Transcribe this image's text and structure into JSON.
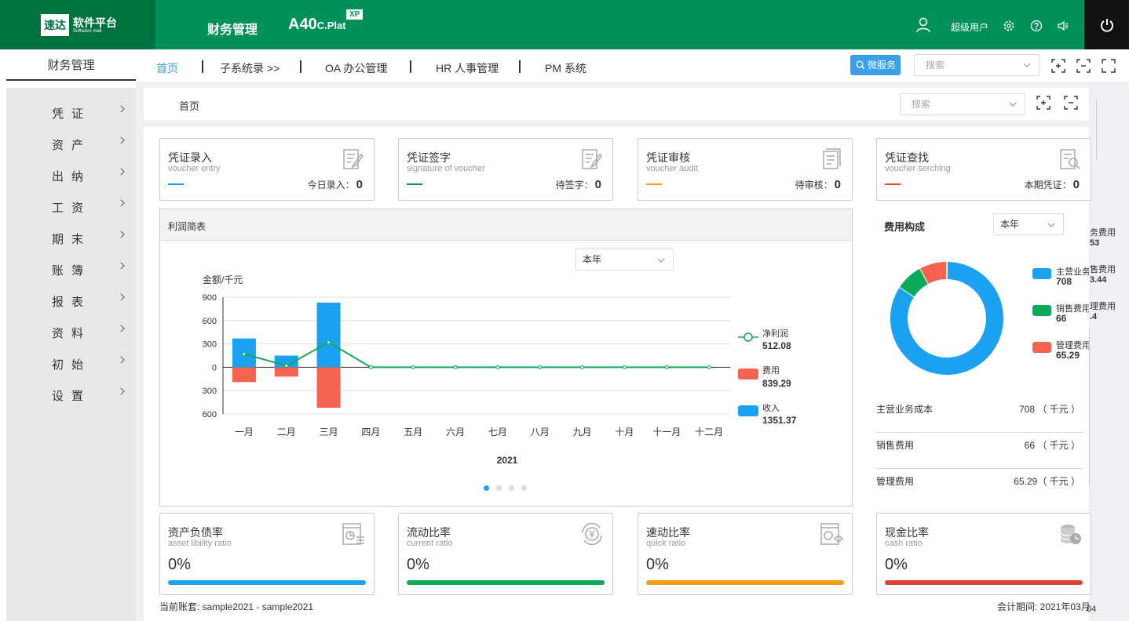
{
  "header": {
    "logo_mark": "速达",
    "logo_text": "软件平台",
    "logo_sub": "Software mall",
    "app_title": "财务管理",
    "brand_main": "A40",
    "brand_sub": "C.Plat",
    "brand_badge": "XP",
    "user_name": "超级用户",
    "icons": [
      "user-icon",
      "gear-icon",
      "help-icon",
      "speaker-icon",
      "power-icon"
    ]
  },
  "module_label": "财务管理",
  "nav": {
    "items": [
      "首页",
      "子系统录 >>",
      "OA 办公管理",
      "HR 人事管理",
      "PM 系统"
    ],
    "micro_label": "微服务",
    "search_placeholder": "搜索"
  },
  "sidebar": {
    "items": [
      "凭证",
      "资产",
      "出纳",
      "工资",
      "期末",
      "账簿",
      "报表",
      "资料",
      "初始",
      "设置"
    ]
  },
  "breadcrumb": {
    "label": "首页",
    "search_placeholder": "搜索"
  },
  "cards": [
    {
      "title": "凭证录入",
      "subtitle": "voucher entry",
      "count_label": "今日录入：",
      "count": "0",
      "color": "#1b9ad8"
    },
    {
      "title": "凭证签字",
      "subtitle": "signature of voucher",
      "count_label": "待签字：",
      "count": "0",
      "color": "#0e8b63"
    },
    {
      "title": "凭证审核",
      "subtitle": "voucher audit",
      "count_label": "待审核：",
      "count": "0",
      "color": "#e8a21a"
    },
    {
      "title": "凭证查找",
      "subtitle": "voucher serching",
      "count_label": "本期凭证：",
      "count": "0",
      "color": "#d9433a"
    }
  ],
  "profit_panel": {
    "title": "利润简表",
    "period": "本年"
  },
  "chart_data": {
    "type": "bar",
    "title": "",
    "ylabel": "金额/千元",
    "xlabel": "2021",
    "categories": [
      "一月",
      "二月",
      "三月",
      "四月",
      "五月",
      "六月",
      "七月",
      "八月",
      "九月",
      "十月",
      "十一月",
      "十二月"
    ],
    "ylim": [
      -600,
      900
    ],
    "yticks": [
      900,
      600,
      300,
      0,
      300,
      600
    ],
    "series": [
      {
        "name": "收入",
        "type": "bar",
        "color": "#1aa1f0",
        "values": [
          370,
          150,
          830,
          0,
          0,
          0,
          0,
          0,
          0,
          0,
          0,
          0
        ]
      },
      {
        "name": "费用",
        "type": "bar",
        "color": "#f4634f",
        "values": [
          -190,
          -120,
          -520,
          0,
          0,
          0,
          0,
          0,
          0,
          0,
          0,
          0
        ]
      },
      {
        "name": "净利润",
        "type": "line",
        "color": "#13a85a",
        "values": [
          170,
          20,
          320,
          0,
          0,
          0,
          0,
          0,
          0,
          0,
          0,
          0
        ]
      }
    ],
    "legend": [
      {
        "name": "净利润",
        "value": "512.08"
      },
      {
        "name": "费用",
        "value": "839.29"
      },
      {
        "name": "收入",
        "value": "1351.37"
      }
    ],
    "legend_position": "right"
  },
  "expense": {
    "title": "费用构成",
    "period": "本年",
    "legend": [
      {
        "name": "主营业务",
        "value": "708",
        "color": "#1aa1f0"
      },
      {
        "name": "销售费用",
        "value": "66",
        "color": "#0bab5b"
      },
      {
        "name": "管理费用",
        "value": "65.29",
        "color": "#f4634f"
      }
    ],
    "rows": [
      {
        "name": "主营业务成本",
        "value": "708 （ 千元 ）"
      },
      {
        "name": "销售费用",
        "value": "66 （ 千元 ）"
      },
      {
        "name": "管理费用",
        "value": "65.29（ 千元 ）"
      }
    ],
    "ghost": [
      "务费用",
      "53",
      "售费用",
      "3.44",
      "理费用",
      ".4"
    ],
    "donut": [
      {
        "name": "主营业务",
        "value": 708,
        "color": "#1aa1f0"
      },
      {
        "name": "销售费用",
        "value": 66,
        "color": "#0bab5b"
      },
      {
        "name": "管理费用",
        "value": 65.29,
        "color": "#f4634f"
      }
    ]
  },
  "ratios": [
    {
      "title": "资产负债率",
      "subtitle": "asset libility ratio",
      "value": "0%",
      "color": "#1aa1f0"
    },
    {
      "title": "流动比率",
      "subtitle": "current ratio",
      "value": "0%",
      "color": "#0bab5b"
    },
    {
      "title": "速动比率",
      "subtitle": "quick ratio",
      "value": "0%",
      "color": "#f2a01a"
    },
    {
      "title": "现金比率",
      "subtitle": "cash ratio",
      "value": "0%",
      "color": "#d9433a"
    }
  ],
  "footer": {
    "account": "当前账套: sample2021 - sample2021",
    "period": "会计期间: 2021年03月",
    "edge_text": "04"
  }
}
